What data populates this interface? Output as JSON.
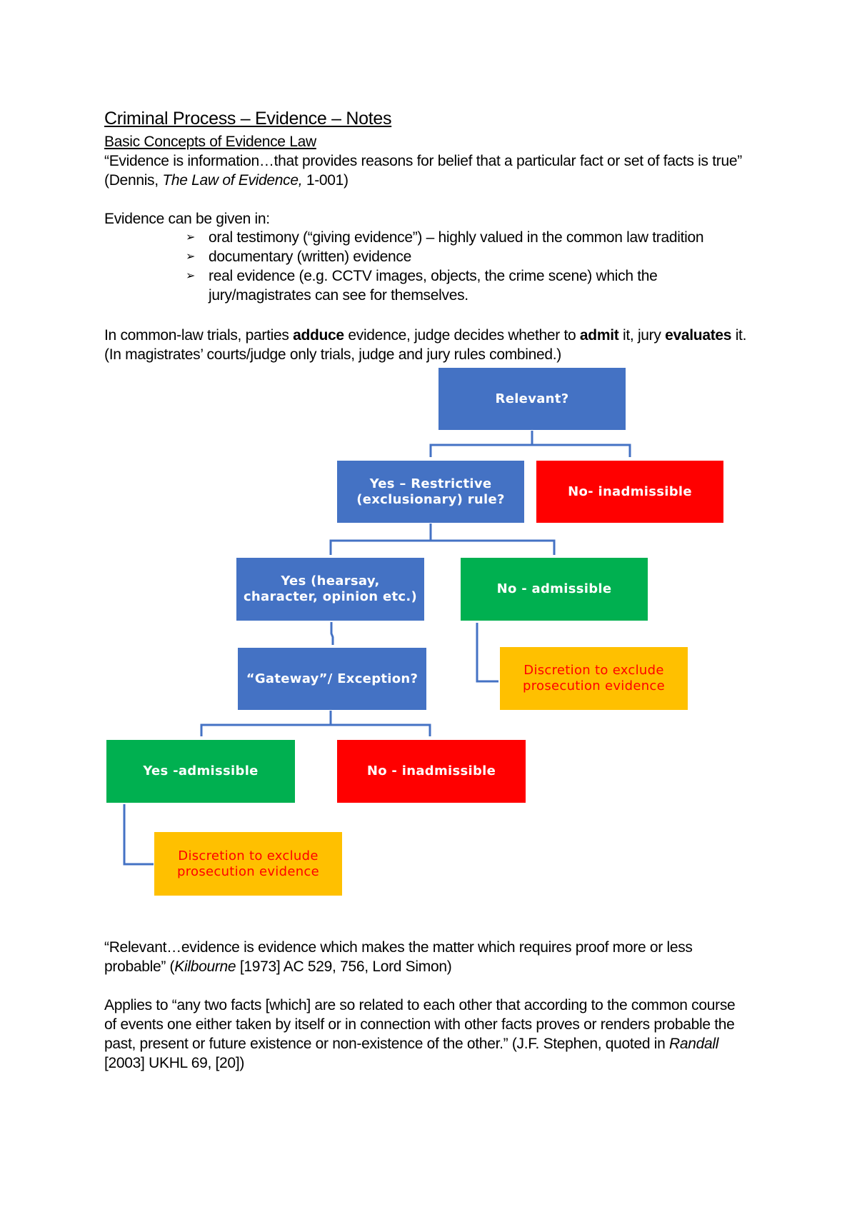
{
  "document": {
    "title": "Criminal Process – Evidence – Notes",
    "subtitle": "Basic Concepts of Evidence Law",
    "definition_quote": "“Evidence is information…that provides reasons for belief that a particular fact or set of facts is true”",
    "definition_citation": {
      "prefix": "(Dennis, ",
      "italic": "The Law of Evidence,",
      "suffix": " 1-001)"
    },
    "forms_intro": "Evidence can be given in:",
    "bullet_glyph": "➢",
    "forms": [
      {
        "line1": "oral testimony (“giving evidence”) – highly valued in the common law tradition",
        "line2": ""
      },
      {
        "line1": "documentary (written) evidence",
        "line2": ""
      },
      {
        "line1": "real evidence (e.g. CCTV images, objects, the crime scene) which the",
        "line2": "jury/magistrates can see for themselves."
      }
    ],
    "roles_paragraph": {
      "p1": "In common-law trials, parties ",
      "b1": "adduce",
      "p2": " evidence, judge decides whether to ",
      "b2": "admit",
      "p3": " it, jury ",
      "b3": "evaluates",
      "p4": " it."
    },
    "roles_note": "(In magistrates’ courts/judge only trials, judge and jury rules combined.)",
    "relevance_quote": {
      "line1": "“Relevant…evidence is evidence which makes the matter which requires proof more or less",
      "line2_prefix": "probable” (",
      "line2_italic": "Kilbourne",
      "line2_suffix": " [1973] AC 529, 756, Lord Simon)"
    },
    "stephen_quote": {
      "line1": "Applies to “any two facts [which] are so related to each other that according to the common course",
      "line2": "of events one either taken by itself or in connection with other facts proves or renders probable the",
      "line3_prefix": "past, present or future existence or non-existence of the other.”  (J.F. Stephen, quoted in ",
      "line3_italic": "Randall",
      "line4": "[2003] UKHL 69, [20])"
    }
  },
  "flowchart": {
    "colors": {
      "question": "#4472c4",
      "inadmissible": "#ff0000",
      "admissible": "#00b050",
      "discretion": "#ffc000",
      "discretion_text": "#ff0000",
      "connector": "#4472c4"
    },
    "nodes": {
      "relevant": "Relevant?",
      "restrictive_rule": "Yes – Restrictive (exclusionary) rule?",
      "no_inadmissible_1": "No- inadmissible",
      "yes_excluded_types": "Yes (hearsay, character, opinion etc.)",
      "no_admissible": "No - admissible",
      "discretion_1": "Discretion to exclude prosecution evidence",
      "gateway": "“Gateway”/ Exception?",
      "yes_admissible": "Yes -admissible",
      "no_inadmissible_2": "No - inadmissible",
      "discretion_2": "Discretion to  exclude prosecution evidence"
    }
  }
}
